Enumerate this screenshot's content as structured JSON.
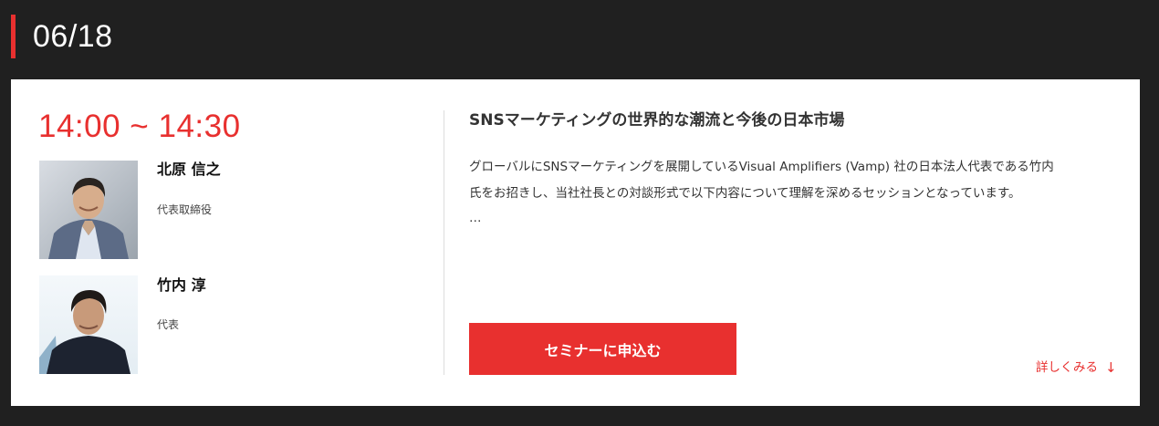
{
  "header": {
    "date": "06/18"
  },
  "session": {
    "time": "14:00 ~ 14:30",
    "speakers": [
      {
        "name": "北原 信之",
        "role": "代表取締役",
        "photo_icon": "speaker-photo"
      },
      {
        "name": "竹内 淳",
        "role": "代表",
        "photo_icon": "speaker-photo"
      }
    ],
    "title": "SNSマーケティングの世界的な潮流と今後の日本市場",
    "description_line1": "グローバルにSNSマーケティングを展開しているVisual Amplifiers (Vamp) 社の日本法人代表である竹内",
    "description_line2": "氏をお招きし、当社社長との対談形式で以下内容について理解を深めるセッションとなっています。",
    "ellipsis": "…",
    "apply_label": "セミナーに申込む",
    "more_label": "詳しくみる",
    "more_icon": "↓"
  },
  "colors": {
    "accent": "#e8302f",
    "page_background": "#202020",
    "card_background": "#ffffff"
  }
}
